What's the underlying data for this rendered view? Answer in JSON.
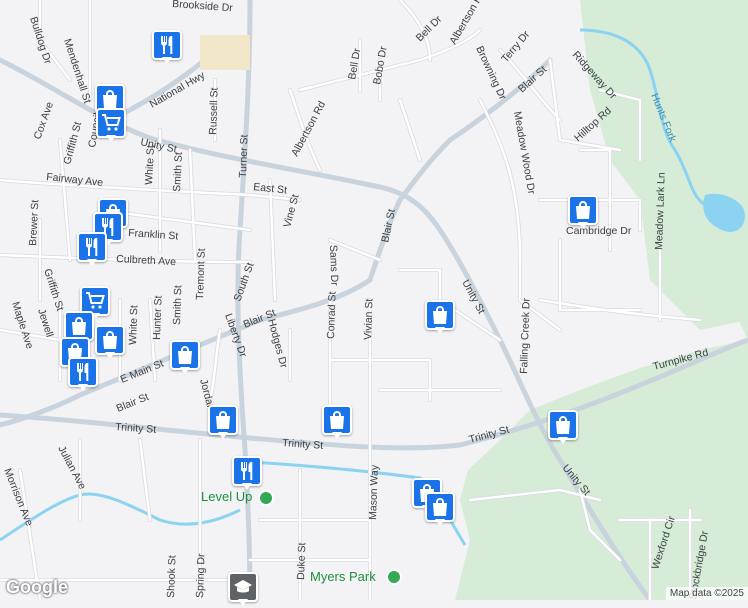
{
  "map": {
    "colors": {
      "background": "#f3f2f5",
      "park": "#d6ecd7",
      "water": "#8bd3f0",
      "road_major": "#c9d3de",
      "road_minor": "#ffffff",
      "pin": "#1a73e8",
      "label": "#3c4043"
    },
    "street_labels": {
      "bulldog_dr": "Bulldog Dr",
      "mendenhall_st": "Mendenhall St",
      "cox_ave": "Cox Ave",
      "griffith_st_n": "Griffith St",
      "council": "Council",
      "national_hwy": "National Hwy",
      "russell_st": "Russell St",
      "unity_st_w": "Unity St",
      "white_st_n": "White St",
      "smith_st_n": "Smith St",
      "turner_st": "Turner St",
      "east_st": "East St",
      "fairway_ave": "Fairway Ave",
      "albertson_rd_w": "Albertson Rd",
      "bell_dr_w": "Bell Dr",
      "bobo_dr": "Bobo Dr",
      "bell_dr_e": "Bell Dr",
      "albertson_rd_e": "Albertson Rd",
      "brookside_dr": "Brookside Dr",
      "brewer_st": "Brewer St",
      "franklin_st": "Franklin St",
      "vine_st": "Vine St",
      "culbreth_ave": "Culbreth Ave",
      "tremont_st": "Tremont St",
      "south_st": "South St",
      "sams_dr": "Sams Dr",
      "blair_st_n": "Blair St",
      "blair_st_top": "Blair St",
      "browning_dr": "Browning Dr",
      "terry_dr": "Terry Dr",
      "ridgeway_dr": "Ridgeway Dr",
      "hilltop_rd": "Hilltop Rd",
      "meadow_wood_dr": "Meadow Wood Dr",
      "hunts_fork": "Hunts Fork",
      "cambridge_dr": "Cambridge Dr",
      "meadow_lark_ln": "Meadow Lark Ln",
      "maple_ave": "Maple Ave",
      "jewell": "Jewell",
      "griffith_st_s": "Griffith St",
      "hunter_st": "Hunter St",
      "smith_st_s": "Smith St",
      "white_st_s": "White St",
      "e_main_st": "E Main St",
      "blair_st_mid": "Blair St",
      "liberty_dr": "Liberty Dr",
      "hodges_dr": "Hodges Dr",
      "conrad_st": "Conrad St",
      "vivian_st": "Vivian St",
      "unity_st_mid": "Unity St",
      "falling_creek_dr": "Falling Creek Dr",
      "turnpike_rd": "Turnpike Rd",
      "blair_st_sw": "Blair St",
      "jordan": "Jordan",
      "trinity_st_w": "Trinity St",
      "trinity_st_mid": "Trinity St",
      "trinity_st_e": "Trinity St",
      "julian_ave": "Julian Ave",
      "morrison_ave": "Morrison Ave",
      "mason_way": "Mason Way",
      "unity_st_se": "Unity St",
      "wexford_cir": "Wexford Cir",
      "stockbridge_dr": "Stockbridge Dr",
      "duke_st": "Duke St",
      "shook_st": "Shook St",
      "spring_dr": "Spring Dr"
    },
    "poi": {
      "level_up": "Level Up",
      "myers_park": "Myers Park"
    },
    "pins": [
      {
        "id": "pin-restaurant-1",
        "type": "restaurant-icon"
      },
      {
        "id": "pin-shopping-1",
        "type": "shopping-bag-icon"
      },
      {
        "id": "pin-cart-1",
        "type": "shopping-cart-icon"
      },
      {
        "id": "pin-shopping-2",
        "type": "shopping-bag-icon"
      },
      {
        "id": "pin-restaurant-2",
        "type": "restaurant-icon"
      },
      {
        "id": "pin-restaurant-3",
        "type": "restaurant-icon"
      },
      {
        "id": "pin-cart-2",
        "type": "shopping-cart-icon"
      },
      {
        "id": "pin-shopping-3",
        "type": "shopping-bag-icon"
      },
      {
        "id": "pin-shopping-4",
        "type": "shopping-bag-icon"
      },
      {
        "id": "pin-shopping-5",
        "type": "shopping-bag-icon"
      },
      {
        "id": "pin-shopping-6",
        "type": "shopping-bag-icon"
      },
      {
        "id": "pin-restaurant-4",
        "type": "restaurant-icon"
      },
      {
        "id": "pin-shopping-7",
        "type": "shopping-bag-icon"
      },
      {
        "id": "pin-shopping-8",
        "type": "shopping-bag-icon"
      },
      {
        "id": "pin-shopping-9",
        "type": "shopping-bag-icon"
      },
      {
        "id": "pin-shopping-10",
        "type": "shopping-bag-icon"
      },
      {
        "id": "pin-shopping-11",
        "type": "shopping-bag-icon"
      },
      {
        "id": "pin-restaurant-5",
        "type": "restaurant-icon"
      },
      {
        "id": "pin-shopping-12",
        "type": "shopping-bag-icon"
      },
      {
        "id": "pin-shopping-13",
        "type": "shopping-bag-icon"
      },
      {
        "id": "pin-school",
        "type": "school-icon"
      }
    ]
  },
  "footer": {
    "logo": "Google",
    "attribution": "Map data ©2025"
  }
}
